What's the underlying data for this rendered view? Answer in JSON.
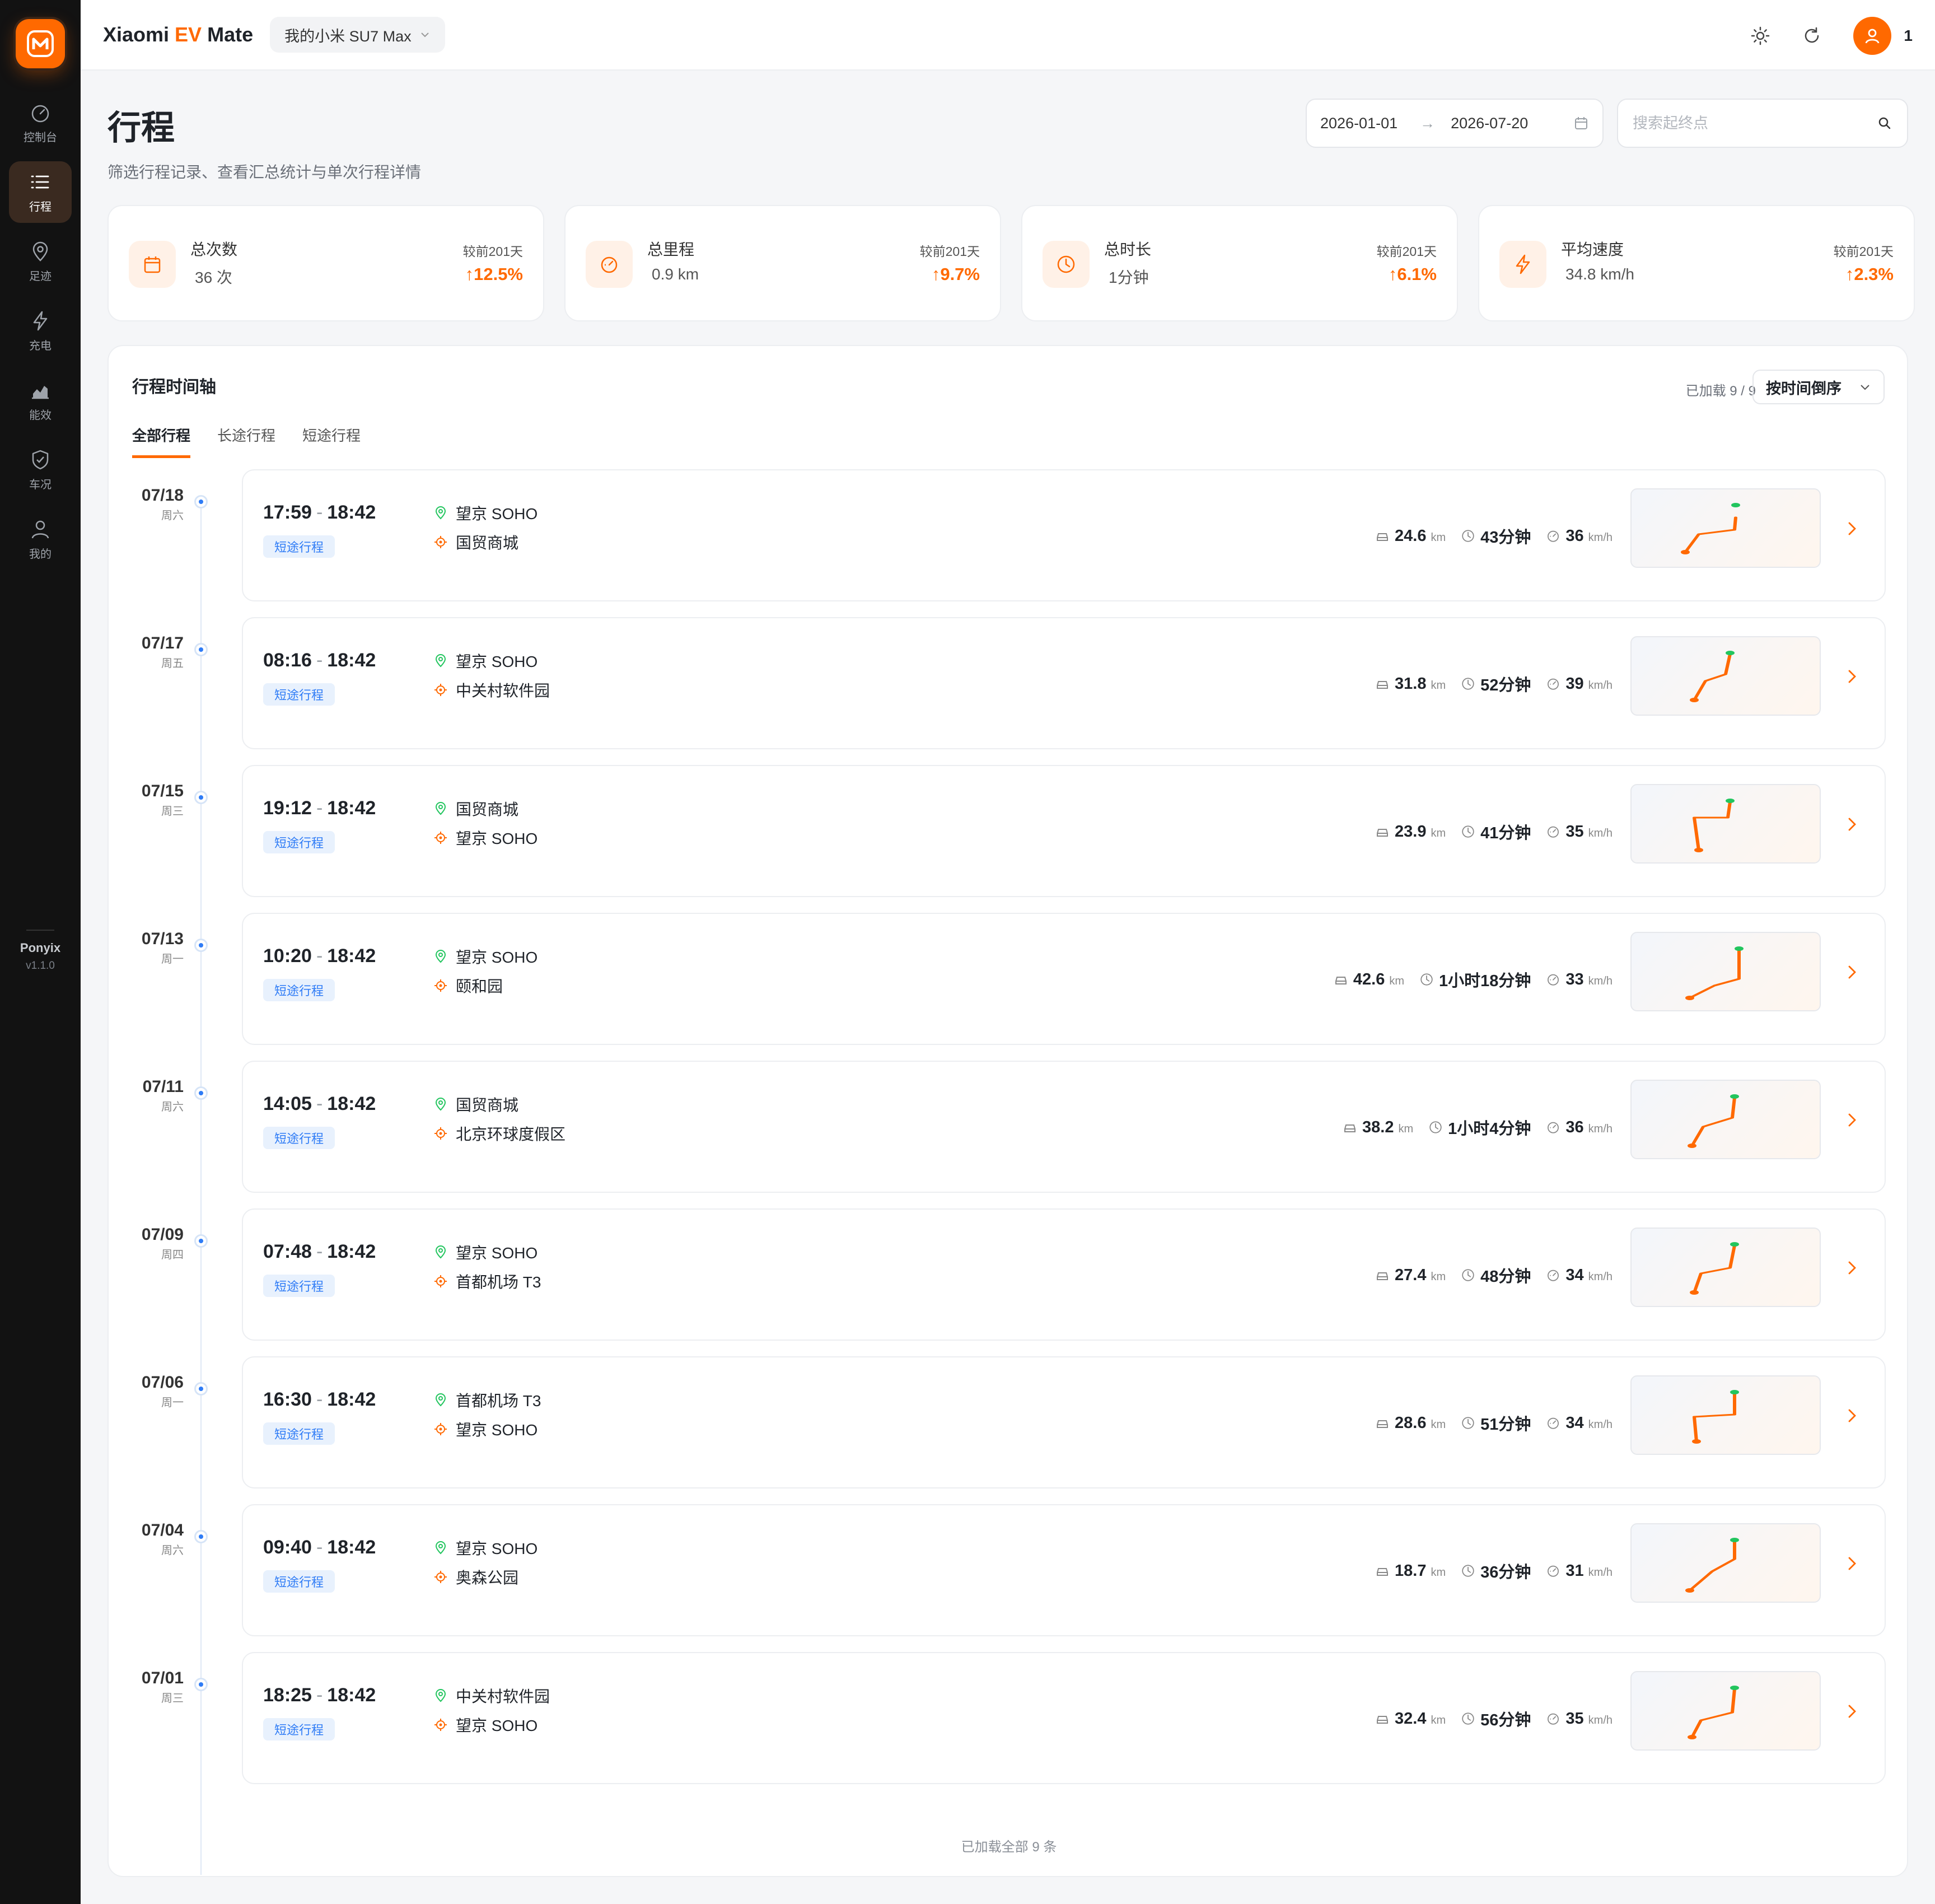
{
  "app": {
    "title_main": "Xiaomi ",
    "title_ev": "EV",
    "title_end": " Mate",
    "car": "我的小米 SU7 Max",
    "user_count": "1"
  },
  "sidebar": {
    "items": [
      {
        "label": "控制台",
        "icon": "dashboard-icon"
      },
      {
        "label": "行程",
        "icon": "list-icon",
        "active": true
      },
      {
        "label": "足迹",
        "icon": "location-pin-icon"
      },
      {
        "label": "充电",
        "icon": "lightning-icon"
      },
      {
        "label": "能效",
        "icon": "chart-icon"
      },
      {
        "label": "车况",
        "icon": "shield-check-icon"
      },
      {
        "label": "我的",
        "icon": "user-icon"
      }
    ],
    "brand": "Ponyix",
    "version": "v1.1.0"
  },
  "header": {
    "title": "行程",
    "subtitle": "筛选行程记录、查看汇总统计与单次行程详情",
    "date_start": "2026-01-01",
    "date_end": "2026-07-20",
    "search_placeholder": "搜索起终点"
  },
  "stats": [
    {
      "label": "总次数",
      "value": "36 次",
      "compare": "较前201天",
      "delta": "↑12.5%",
      "icon": "calendar-icon"
    },
    {
      "label": "总里程",
      "value": "0.9 km",
      "compare": "较前201天",
      "delta": "↑9.7%",
      "icon": "speedometer-icon"
    },
    {
      "label": "总时长",
      "value": "1分钟",
      "compare": "较前201天",
      "delta": "↑6.1%",
      "icon": "clock-icon"
    },
    {
      "label": "平均速度",
      "value": "34.8 km/h",
      "compare": "较前201天",
      "delta": "↑2.3%",
      "icon": "lightning-icon"
    }
  ],
  "timeline": {
    "title": "行程时间轴",
    "loaded": "已加载 9 / 9",
    "sort_label": "按时间倒序",
    "tabs": [
      "全部行程",
      "长途行程",
      "短途行程"
    ],
    "footer": "已加载全部 9 条",
    "trips": [
      {
        "date": "07/18",
        "weekday": "周六",
        "start": "17:59",
        "end": "18:42",
        "tag": "短途行程",
        "from": "望京 SOHO",
        "to": "国贸商城",
        "distance": "24.6",
        "distance_unit": "km",
        "duration": "43分钟",
        "speed": "36",
        "speed_unit": "km/h"
      },
      {
        "date": "07/17",
        "weekday": "周五",
        "start": "08:16",
        "end": "18:42",
        "tag": "短途行程",
        "from": "望京 SOHO",
        "to": "中关村软件园",
        "distance": "31.8",
        "distance_unit": "km",
        "duration": "52分钟",
        "speed": "39",
        "speed_unit": "km/h"
      },
      {
        "date": "07/15",
        "weekday": "周三",
        "start": "19:12",
        "end": "18:42",
        "tag": "短途行程",
        "from": "国贸商城",
        "to": "望京 SOHO",
        "distance": "23.9",
        "distance_unit": "km",
        "duration": "41分钟",
        "speed": "35",
        "speed_unit": "km/h"
      },
      {
        "date": "07/13",
        "weekday": "周一",
        "start": "10:20",
        "end": "18:42",
        "tag": "短途行程",
        "from": "望京 SOHO",
        "to": "颐和园",
        "distance": "42.6",
        "distance_unit": "km",
        "duration": "1小时18分钟",
        "speed": "33",
        "speed_unit": "km/h"
      },
      {
        "date": "07/11",
        "weekday": "周六",
        "start": "14:05",
        "end": "18:42",
        "tag": "短途行程",
        "from": "国贸商城",
        "to": "北京环球度假区",
        "distance": "38.2",
        "distance_unit": "km",
        "duration": "1小时4分钟",
        "speed": "36",
        "speed_unit": "km/h"
      },
      {
        "date": "07/09",
        "weekday": "周四",
        "start": "07:48",
        "end": "18:42",
        "tag": "短途行程",
        "from": "望京 SOHO",
        "to": "首都机场 T3",
        "distance": "27.4",
        "distance_unit": "km",
        "duration": "48分钟",
        "speed": "34",
        "speed_unit": "km/h"
      },
      {
        "date": "07/06",
        "weekday": "周一",
        "start": "16:30",
        "end": "18:42",
        "tag": "短途行程",
        "from": "首都机场 T3",
        "to": "望京 SOHO",
        "distance": "28.6",
        "distance_unit": "km",
        "duration": "51分钟",
        "speed": "34",
        "speed_unit": "km/h"
      },
      {
        "date": "07/04",
        "weekday": "周六",
        "start": "09:40",
        "end": "18:42",
        "tag": "短途行程",
        "from": "望京 SOHO",
        "to": "奥森公园",
        "distance": "18.7",
        "distance_unit": "km",
        "duration": "36分钟",
        "speed": "31",
        "speed_unit": "km/h"
      },
      {
        "date": "07/01",
        "weekday": "周三",
        "start": "18:25",
        "end": "18:42",
        "tag": "短途行程",
        "from": "中关村软件园",
        "to": "望京 SOHO",
        "distance": "32.4",
        "distance_unit": "km",
        "duration": "56分钟",
        "speed": "35",
        "speed_unit": "km/h"
      }
    ]
  },
  "colors": {
    "accent": "#ff6900",
    "start_dot": "#22c55e",
    "tag_blue": "#2f7cf6"
  }
}
